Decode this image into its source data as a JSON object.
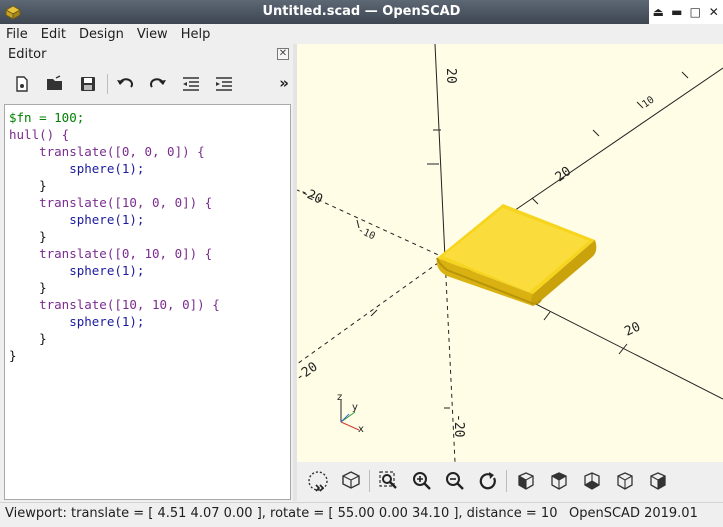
{
  "window": {
    "title": "Untitled.scad — OpenSCAD"
  },
  "menu": [
    "File",
    "Edit",
    "Design",
    "View",
    "Help"
  ],
  "editor": {
    "title": "Editor",
    "toolbar": [
      "new-file-icon",
      "open-file-icon",
      "save-icon",
      "undo-icon",
      "redo-icon",
      "unindent-icon",
      "indent-icon"
    ],
    "more": "»",
    "lines": [
      "$fn = 100;",
      "hull() {",
      "    translate([0, 0, 0]) {",
      "        sphere(1);",
      "    }",
      "    translate([10, 0, 0]) {",
      "        sphere(1);",
      "    }",
      "    translate([0, 10, 0]) {",
      "        sphere(1);",
      "    }",
      "    translate([10, 10, 0]) {",
      "        sphere(1);",
      "    }",
      "}"
    ]
  },
  "viewport": {
    "axis_labels": [
      "20",
      "-20",
      "20",
      "-20",
      "20",
      "-20",
      "10",
      "-10"
    ],
    "gizmo": {
      "x": "x",
      "y": "y",
      "z": "z"
    },
    "colors": {
      "background": "#fffde6",
      "object": "#f7d51f"
    }
  },
  "view_toolbar": [
    "preview-icon",
    "render-icon",
    "zoom-all-icon",
    "zoom-in-icon",
    "zoom-out-icon",
    "reset-view-icon",
    "view-right-icon",
    "view-top-icon",
    "view-bottom-icon",
    "view-left-icon",
    "view-front-icon"
  ],
  "status": {
    "viewport": "Viewport: translate = [ 4.51 4.07 0.00 ], rotate = [ 55.00 0.00 34.10 ], distance = 10",
    "app": "OpenSCAD 2019.01"
  }
}
